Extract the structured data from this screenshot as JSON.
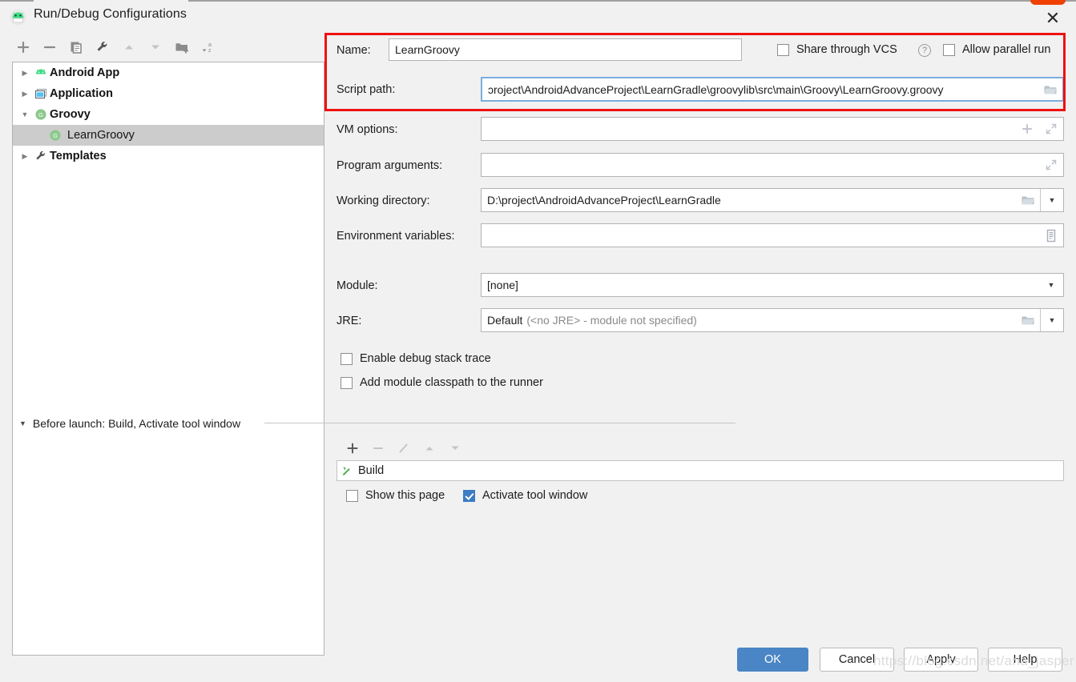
{
  "window": {
    "title": "Run/Debug Configurations",
    "app_icon": "android-studio-icon",
    "close_label": "✕"
  },
  "left_toolbar": {
    "buttons": [
      {
        "name": "add-configuration-button",
        "icon": "plus-icon",
        "glyph": "+",
        "enabled": true
      },
      {
        "name": "remove-configuration-button",
        "icon": "minus-icon",
        "glyph": "−",
        "enabled": true
      },
      {
        "name": "copy-configuration-button",
        "icon": "copy-icon",
        "glyph": "",
        "enabled": true
      },
      {
        "name": "edit-templates-button",
        "icon": "wrench-icon",
        "glyph": "",
        "enabled": true
      },
      {
        "name": "move-up-button",
        "icon": "arrow-up-icon",
        "glyph": "▲",
        "enabled": false
      },
      {
        "name": "move-down-button",
        "icon": "arrow-down-icon",
        "glyph": "▼",
        "enabled": false
      },
      {
        "name": "new-folder-button",
        "icon": "new-folder-icon",
        "glyph": "",
        "enabled": true
      },
      {
        "name": "sort-configurations-button",
        "icon": "sort-az-icon",
        "glyph": "",
        "enabled": true
      }
    ]
  },
  "tree": {
    "items": [
      {
        "label": "Android App",
        "icon": "android-icon",
        "twisty": "collapsed",
        "depth": 0,
        "bold": true,
        "selected": false
      },
      {
        "label": "Application",
        "icon": "application-icon",
        "twisty": "collapsed",
        "depth": 0,
        "bold": true,
        "selected": false
      },
      {
        "label": "Groovy",
        "icon": "groovy-icon",
        "twisty": "expanded",
        "depth": 0,
        "bold": true,
        "selected": false
      },
      {
        "label": "LearnGroovy",
        "icon": "groovy-icon",
        "twisty": "none",
        "depth": 1,
        "bold": false,
        "selected": true
      },
      {
        "label": "Templates",
        "icon": "wrench-icon",
        "twisty": "collapsed",
        "depth": 0,
        "bold": true,
        "selected": false
      }
    ]
  },
  "form": {
    "name_label": "Name:",
    "name_value": "LearnGroovy",
    "share_vcs_label": "Share through VCS",
    "share_vcs_checked": false,
    "share_vcs_help": "?",
    "allow_parallel_label": "Allow parallel run",
    "allow_parallel_checked": false,
    "script_path_label": "Script path:",
    "script_path_value": "ɔroject\\AndroidAdvanceProject\\LearnGradle\\groovylib\\src\\main\\Groovy\\LearnGroovy.groovy",
    "vm_options_label": "VM options:",
    "vm_options_value": "",
    "program_arguments_label": "Program arguments:",
    "program_arguments_value": "",
    "working_directory_label": "Working directory:",
    "working_directory_value": "D:\\project\\AndroidAdvanceProject\\LearnGradle",
    "environment_variables_label": "Environment variables:",
    "environment_variables_value": "",
    "module_label": "Module:",
    "module_value": "[none]",
    "jre_label": "JRE:",
    "jre_value": "Default",
    "jre_hint": "(<no JRE> - module not specified)",
    "enable_debug_stack_trace_label": "Enable debug stack trace",
    "enable_debug_stack_trace_checked": false,
    "add_module_classpath_label": "Add module classpath to the runner",
    "add_module_classpath_checked": false
  },
  "before_launch": {
    "title": "Before launch: Build, Activate tool window",
    "caret": "▼",
    "toolbar": [
      {
        "name": "before-launch-add-button",
        "icon": "plus-icon",
        "glyph": "+",
        "enabled": true
      },
      {
        "name": "before-launch-remove-button",
        "icon": "minus-icon",
        "glyph": "−",
        "enabled": false
      },
      {
        "name": "before-launch-edit-button",
        "icon": "pencil-icon",
        "glyph": "",
        "enabled": false
      },
      {
        "name": "before-launch-up-button",
        "icon": "arrow-up-icon",
        "glyph": "▲",
        "enabled": false
      },
      {
        "name": "before-launch-down-button",
        "icon": "arrow-down-icon",
        "glyph": "▼",
        "enabled": false
      }
    ],
    "tasks": [
      {
        "label": "Build",
        "icon": "build-hammer-icon"
      }
    ],
    "show_this_page_label": "Show this page",
    "show_this_page_checked": false,
    "activate_tool_window_label": "Activate tool window",
    "activate_tool_window_checked": true
  },
  "buttons": {
    "ok": "OK",
    "cancel": "Cancel",
    "apply": "Apply",
    "help": "Help"
  },
  "watermark": "https://blog.csdn.net/aria_jasper",
  "colors": {
    "accent": "#4a86c5",
    "annotation": "#ee1111",
    "selection": "#cccccc",
    "background": "#f1f1f1",
    "groovy_green": "#7cc47c",
    "android_green": "#3ddc84"
  }
}
